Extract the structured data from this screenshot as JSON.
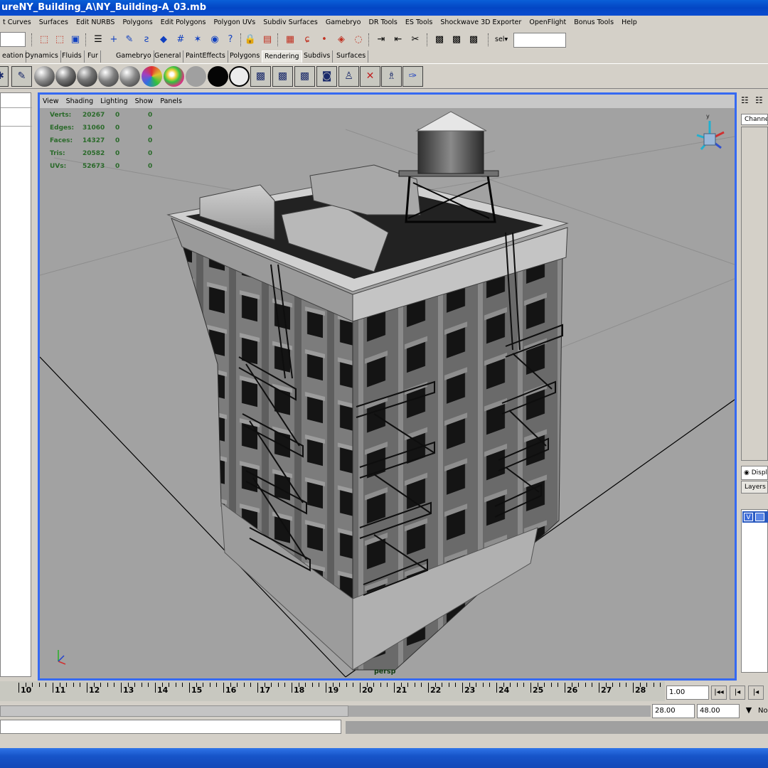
{
  "window": {
    "title": "ureNY_Building_A\\NY_Building-A_03.mb"
  },
  "menu": [
    "t Curves",
    "Surfaces",
    "Edit NURBS",
    "Polygons",
    "Edit Polygons",
    "Polygon UVs",
    "Subdiv Surfaces",
    "Gamebryo",
    "DR Tools",
    "ES Tools",
    "Shockwave 3D Exporter",
    "OpenFlight",
    "Bonus Tools",
    "Help"
  ],
  "statusline": {
    "select_label": "sel▾"
  },
  "shelf_tabs": [
    "eation",
    "Dynamics",
    "Fluids",
    "Fur",
    "Gamebryo",
    "General",
    "PaintEffects",
    "Polygons",
    "Rendering",
    "Subdivs",
    "Surfaces"
  ],
  "active_shelf_tab": "Rendering",
  "viewport": {
    "menu": [
      "View",
      "Shading",
      "Lighting",
      "Show",
      "Panels"
    ],
    "camera_label": "persp",
    "hud": [
      {
        "label": "Verts:",
        "v1": "20267",
        "v2": "0",
        "v3": "0"
      },
      {
        "label": "Edges:",
        "v1": "31060",
        "v2": "0",
        "v3": "0"
      },
      {
        "label": "Faces:",
        "v1": "14327",
        "v2": "0",
        "v3": "0"
      },
      {
        "label": "Tris:",
        "v1": "20582",
        "v2": "0",
        "v3": "0"
      },
      {
        "label": "UVs:",
        "v1": "52673",
        "v2": "0",
        "v3": "0"
      }
    ]
  },
  "right_panel": {
    "channel_box_label": "Channel",
    "display_label": "Displ",
    "layers_label": "Layers",
    "layer_visible": "V"
  },
  "timeline": {
    "labels": [
      "10",
      "11",
      "12",
      "13",
      "14",
      "15",
      "16",
      "17",
      "18",
      "19",
      "20",
      "21",
      "22",
      "23",
      "24",
      "25",
      "26",
      "27",
      "28"
    ],
    "current_time": "1.00",
    "range_start": "28.00",
    "range_end": "48.00",
    "extra": "No"
  },
  "colors": {
    "viewport_border": "#3569f2",
    "viewport_bg": "#a2a2a2",
    "hud_text": "#2a6a2a",
    "title_bar": "#0346c4"
  }
}
